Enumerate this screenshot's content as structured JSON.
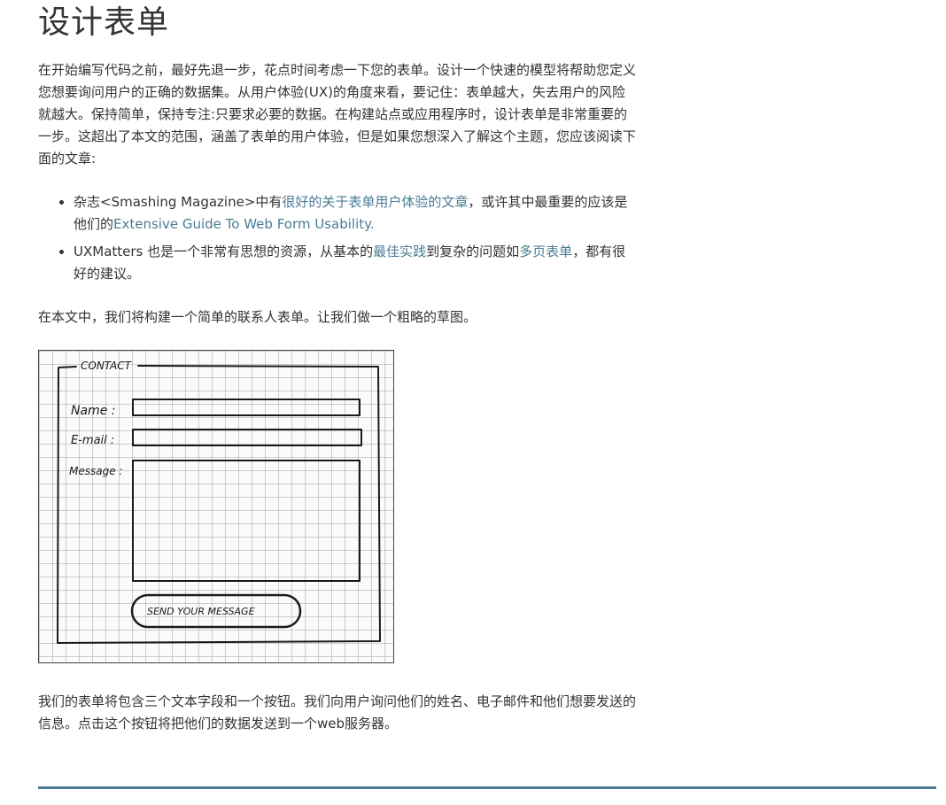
{
  "page": {
    "title": "设计表单"
  },
  "intro": "在开始编写代码之前，最好先退一步，花点时间考虑一下您的表单。设计一个快速的模型将帮助您定义您想要询问用户的正确的数据集。从用户体验(UX)的角度来看，要记住：表单越大，失去用户的风险就越大。保持简单，保持专注:只要求必要的数据。在构建站点或应用程序时，设计表单是非常重要的一步。这超出了本文的范围，涵盖了表单的用户体验，但是如果您想深入了解这个主题，您应该阅读下面的文章:",
  "references": [
    {
      "before": "杂志<Smashing Magazine>中有",
      "link1": "很好的关于表单用户体验的文章",
      "middle": "，或许其中最重要的应该是他们的",
      "link2": "Extensive Guide To Web Form Usability.",
      "after": ""
    },
    {
      "before": "UXMatters 也是一个非常有思想的资源，从基本的",
      "link1": "最佳实践",
      "middle": "到复杂的问题如",
      "link2": "多页表单",
      "after": "，都有很好的建议。"
    }
  ],
  "sketch_intro": "在本文中，我们将构建一个简单的联系人表单。让我们做一个粗略的草图。",
  "sketch": {
    "legend": "CONTACT",
    "name_label": "Name :",
    "email_label": "E-mail :",
    "message_label": "Message :",
    "button_label": "SEND YOUR MESSAGE"
  },
  "outro": "我们的表单将包含三个文本字段和一个按钮。我们向用户询问他们的姓名、电子邮件和他们想要发送的信息。点击这个按钮将把他们的数据发送到一个web服务器。",
  "colors": {
    "link": "#4a7c96",
    "text": "#333333",
    "rule": "#4a7c96"
  }
}
